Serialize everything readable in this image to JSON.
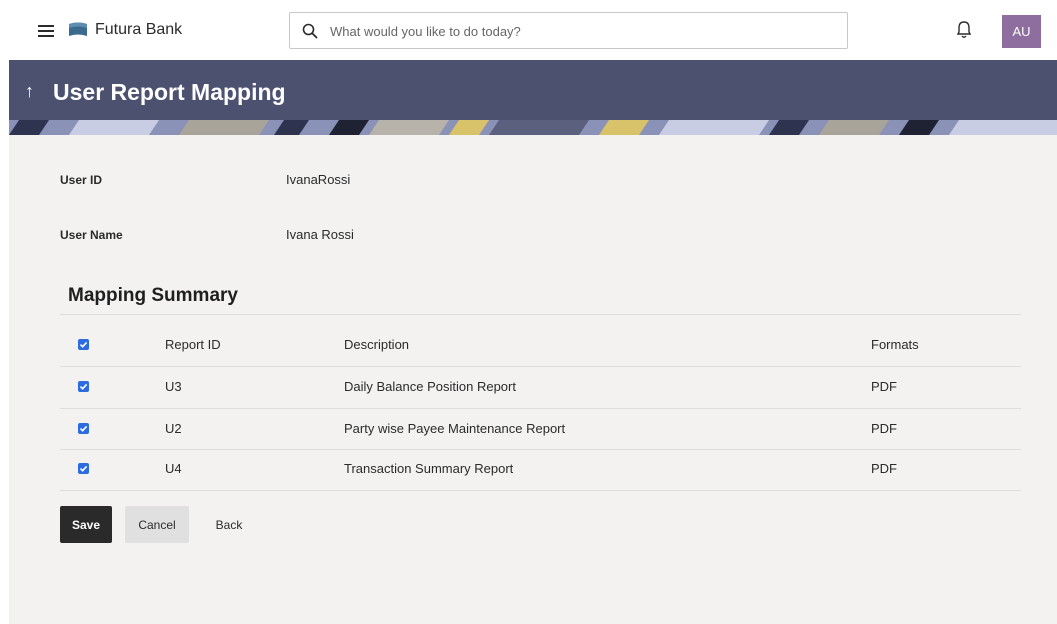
{
  "header": {
    "brand": "Futura Bank",
    "search_placeholder": "What would you like to do today?",
    "avatar_initials": "AU"
  },
  "banner": {
    "title": "User Report Mapping",
    "back_arrow": "↑"
  },
  "user": {
    "id_label": "User ID",
    "id_value": "IvanaRossi",
    "name_label": "User Name",
    "name_value": "Ivana Rossi"
  },
  "summary": {
    "title": "Mapping Summary",
    "columns": [
      "Report ID",
      "Description",
      "Formats"
    ],
    "rows": [
      {
        "report_id": "U3",
        "description": "Daily Balance Position Report",
        "format": "PDF",
        "checked": true
      },
      {
        "report_id": "U2",
        "description": "Party wise Payee Maintenance Report",
        "format": "PDF",
        "checked": true
      },
      {
        "report_id": "U4",
        "description": "Transaction Summary Report",
        "format": "PDF",
        "checked": true
      }
    ]
  },
  "actions": {
    "save": "Save",
    "cancel": "Cancel",
    "back": "Back"
  },
  "colors": {
    "banner": "#4c5170",
    "checkbox": "#2d6cdf",
    "avatar": "#8e6e9e",
    "primary_button": "#2a2a2a"
  },
  "icons": [
    "menu-icon",
    "bank-logo-icon",
    "search-icon",
    "bell-icon",
    "checkbox-checked-icon",
    "back-arrow-icon"
  ]
}
